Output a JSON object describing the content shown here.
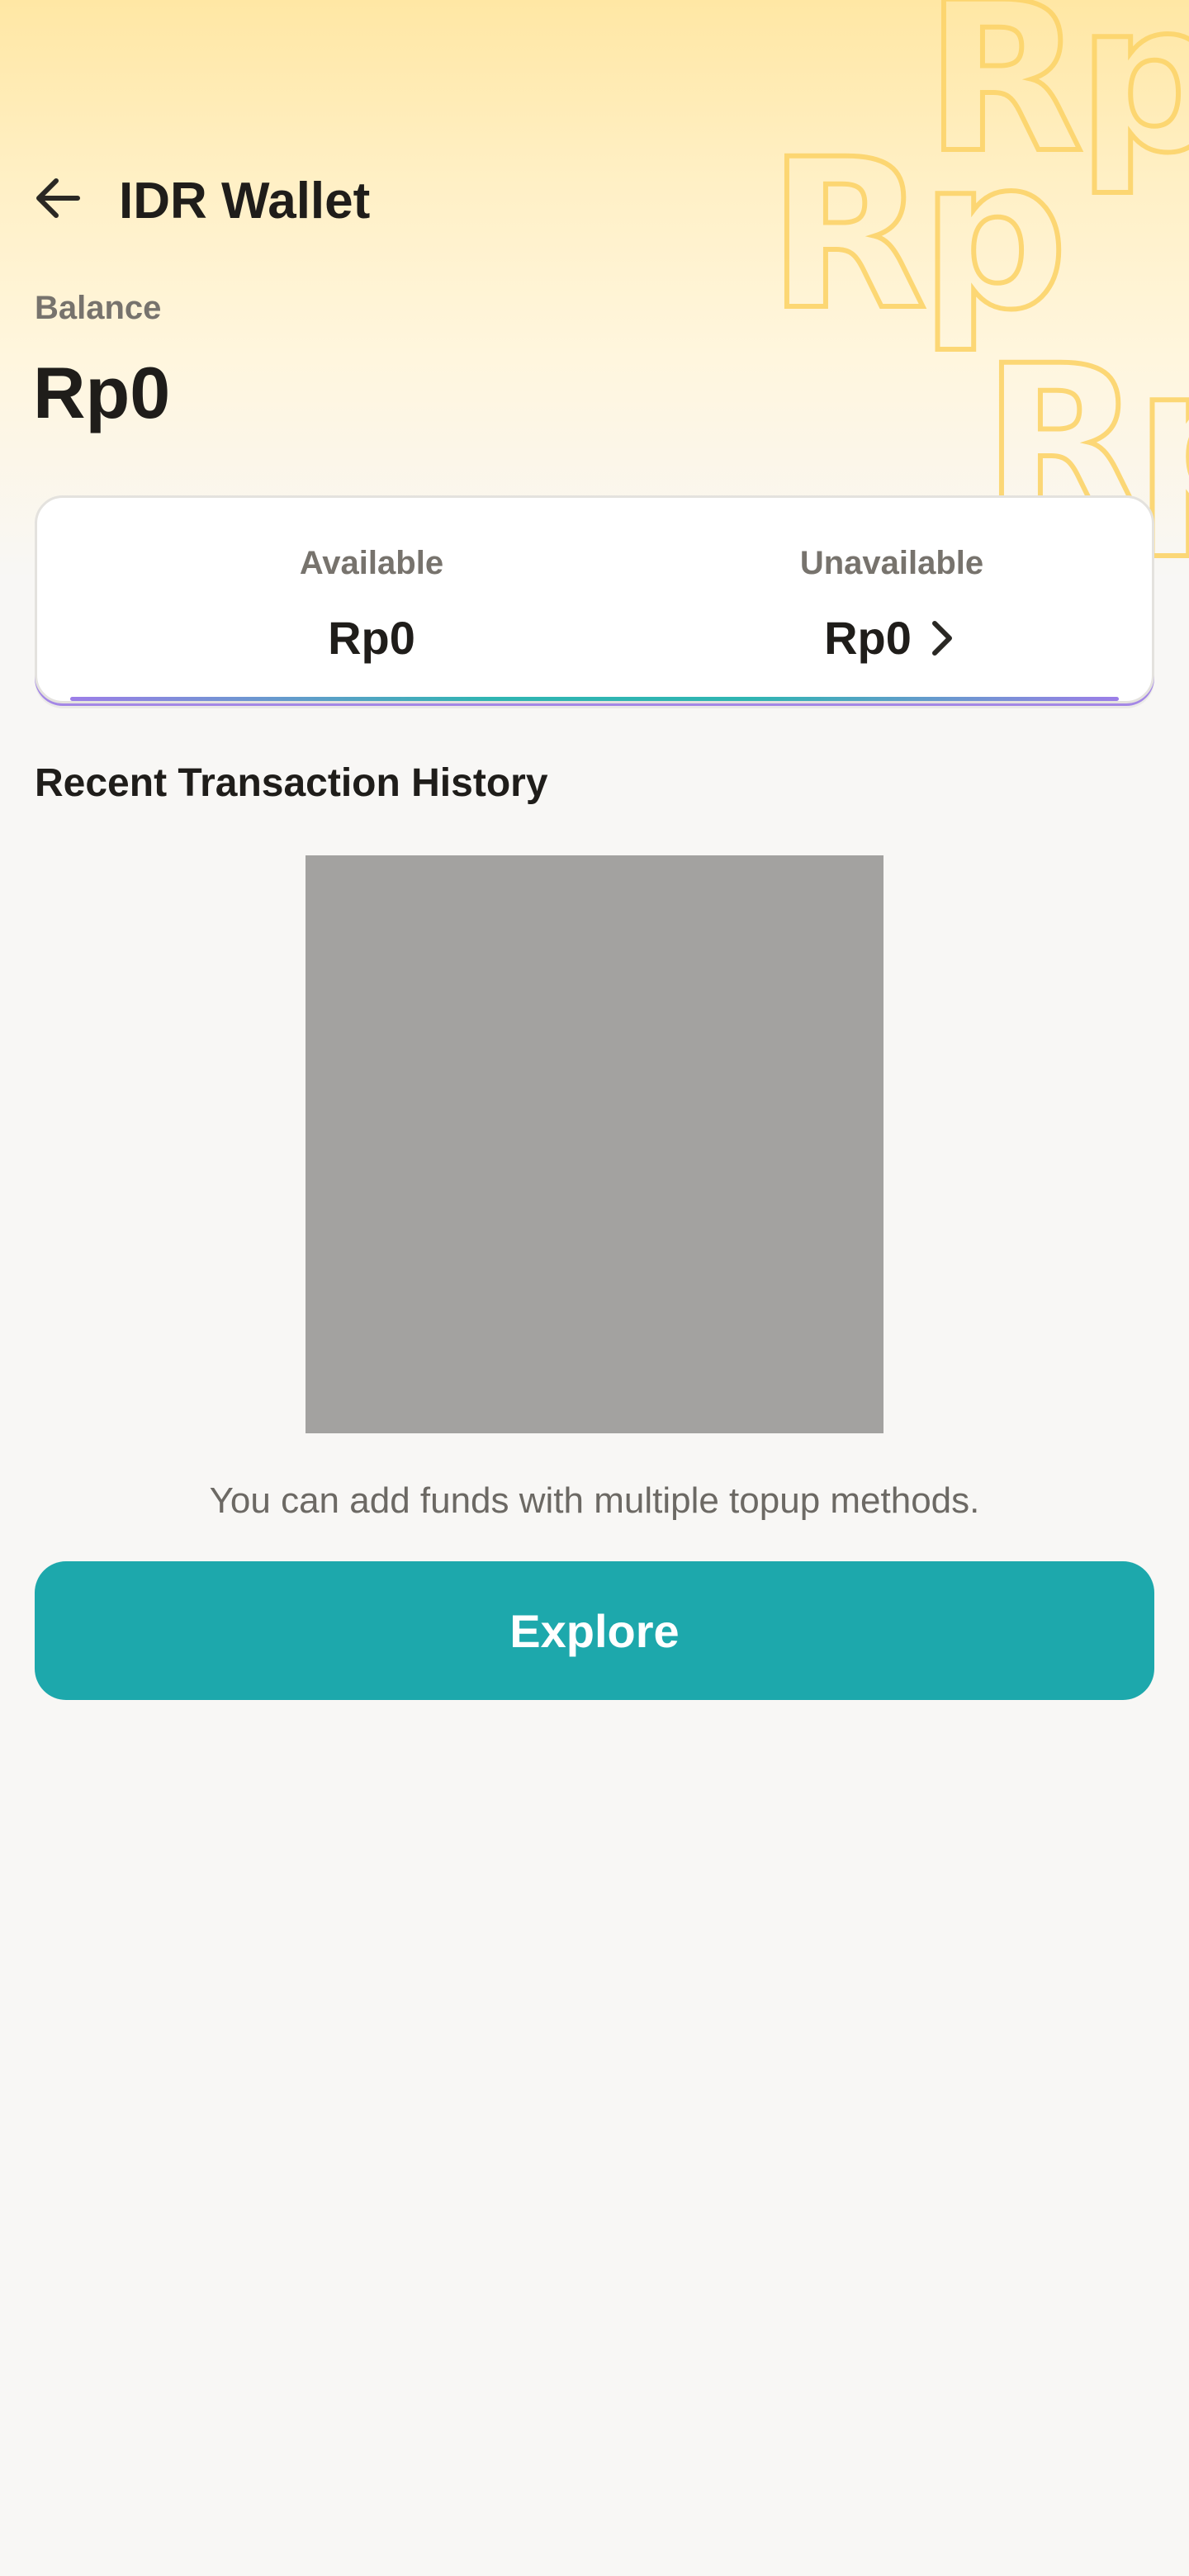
{
  "header": {
    "title": "IDR Wallet",
    "back_icon": "arrow-left-icon",
    "background_text": "Rp",
    "background_colors": [
      "#ffe7a4",
      "#fff6de"
    ]
  },
  "balance": {
    "label": "Balance",
    "value": "Rp0"
  },
  "balance_card": {
    "available": {
      "label": "Available",
      "value": "Rp0"
    },
    "unavailable": {
      "label": "Unavailable",
      "value": "Rp0",
      "icon": "chevron-right-icon"
    }
  },
  "history": {
    "title": "Recent Transaction History",
    "empty_message": "You can add funds with multiple topup methods.",
    "action_label": "Explore"
  },
  "colors": {
    "accent": "#1da8ac",
    "text": "#1f1d1a",
    "muted": "#77736d"
  }
}
